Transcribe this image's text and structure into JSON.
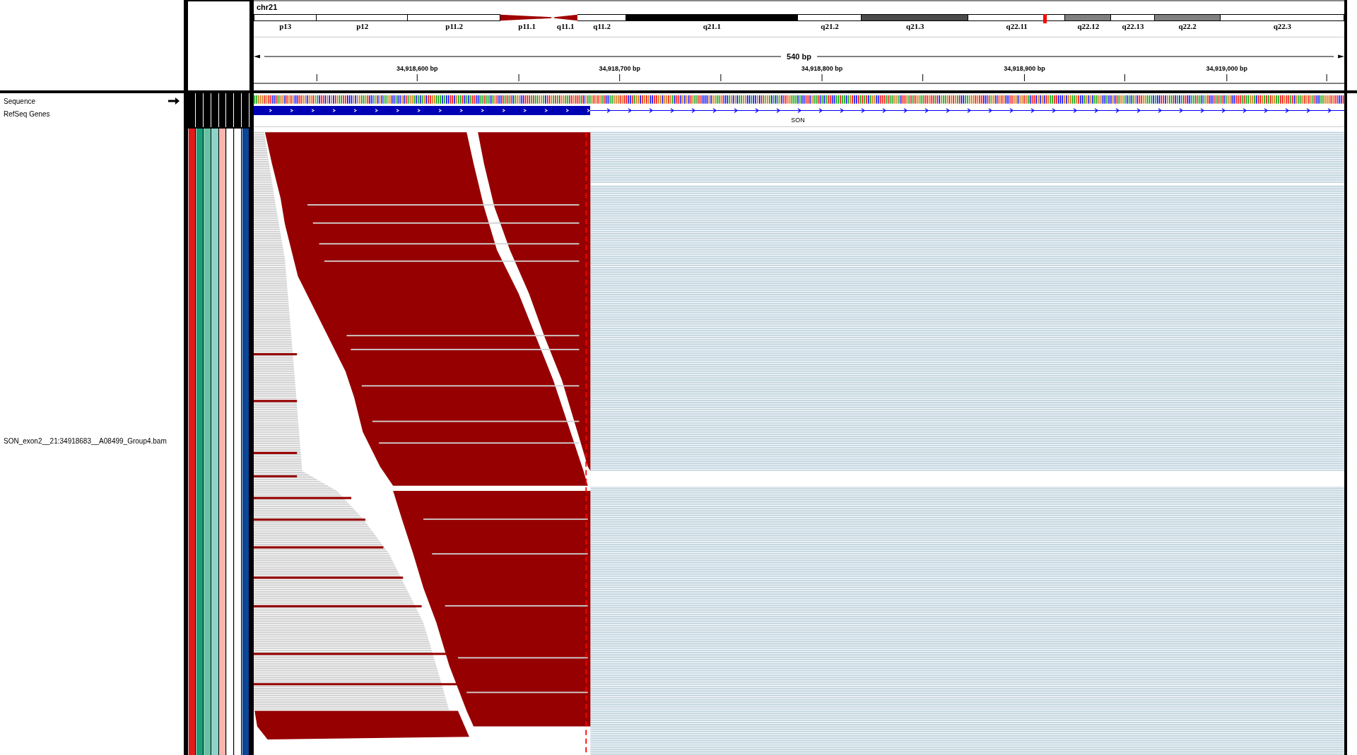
{
  "chromosome": {
    "name": "chr21",
    "cytobands": [
      {
        "label": "p13",
        "kind": "band",
        "color": "#ffffff"
      },
      {
        "label": "p12",
        "kind": "band",
        "color": "#ffffff"
      },
      {
        "label": "p11.2",
        "kind": "band",
        "color": "#ffffff"
      },
      {
        "label": "p11.1",
        "kind": "centromere-p",
        "color": "#a00000"
      },
      {
        "label": "q11.1",
        "kind": "centromere-q",
        "color": "#a00000"
      },
      {
        "label": "q11.2",
        "kind": "band",
        "color": "#ffffff"
      },
      {
        "label": "q21.1",
        "kind": "band",
        "color": "#000000"
      },
      {
        "label": "q21.2",
        "kind": "band",
        "color": "#ffffff"
      },
      {
        "label": "q21.3",
        "kind": "band",
        "color": "#4b4b4b"
      },
      {
        "label": "q22.11",
        "kind": "band",
        "color": "#ffffff"
      },
      {
        "label": "q22.12",
        "kind": "band",
        "color": "#808080"
      },
      {
        "label": "q22.13",
        "kind": "band",
        "color": "#ffffff"
      },
      {
        "label": "q22.2",
        "kind": "band",
        "color": "#808080"
      },
      {
        "label": "q22.3",
        "kind": "band",
        "color": "#ffffff"
      }
    ]
  },
  "ruler": {
    "span": "540 bp",
    "ticks": [
      "34,918,600 bp",
      "34,918,700 bp",
      "34,918,800 bp",
      "34,918,900 bp",
      "34,919,000 bp"
    ]
  },
  "tracks": [
    {
      "kind": "sequence",
      "name": "Sequence"
    },
    {
      "kind": "gene",
      "name": "RefSeq Genes",
      "gene": "SON"
    },
    {
      "kind": "alignment",
      "name": "SON_exon2__21:34918683__A08499_Group4.bam",
      "attributes": [
        {
          "color": "#e31a1c"
        },
        {
          "color": "#1b9e77"
        },
        {
          "color": "#66c2a5"
        },
        {
          "color": "#8dd3c7"
        },
        {
          "color": "#fbb4ae"
        },
        {
          "color": "#ffffff"
        },
        {
          "color": "#ffffff"
        },
        {
          "color": "#0b4596"
        }
      ]
    }
  ]
}
